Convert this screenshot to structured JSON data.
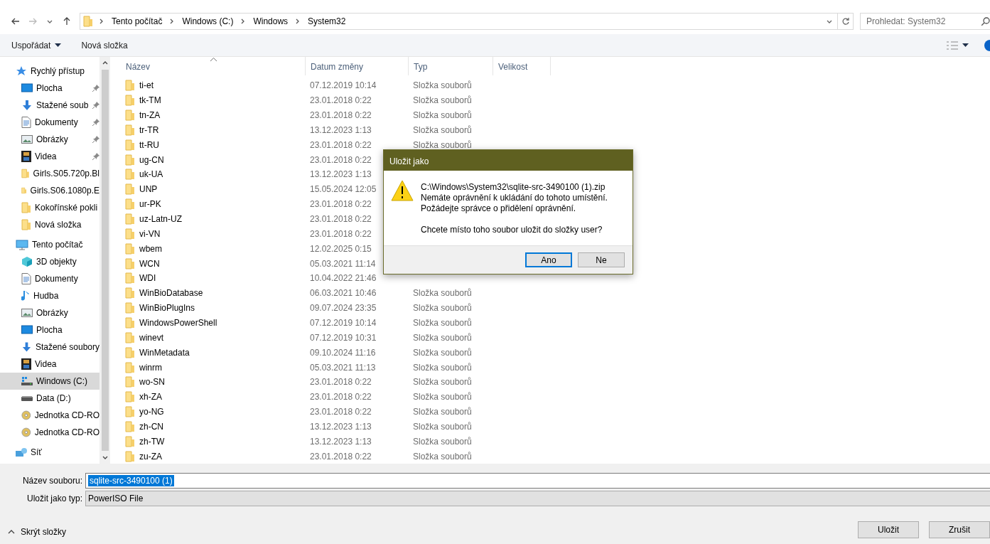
{
  "address_bar": {
    "breadcrumbs": [
      "Tento počítač",
      "Windows (C:)",
      "Windows",
      "System32"
    ],
    "search": {
      "placeholder": "Prohledat: System32"
    }
  },
  "toolbar": {
    "buttons": [
      {
        "label": "Uspořádat",
        "dropdown": true
      },
      {
        "label": "Nová složka",
        "dropdown": false
      }
    ]
  },
  "sidebar": {
    "sections": [
      {
        "label": "Rychlý přístup",
        "kind": "quick-access",
        "selected": false,
        "children": [
          {
            "label": "Plocha",
            "kind": "desktop",
            "pinned": true,
            "selected": false
          },
          {
            "label": "Stažené soub",
            "kind": "downloads",
            "pinned": true,
            "selected": false
          },
          {
            "label": "Dokumenty",
            "kind": "documents",
            "pinned": true,
            "selected": false
          },
          {
            "label": "Obrázky",
            "kind": "pictures",
            "pinned": true,
            "selected": false
          },
          {
            "label": "Videa",
            "kind": "videos",
            "pinned": true,
            "selected": false
          },
          {
            "label": "Girls.S05.720p.Bl",
            "kind": "folder",
            "pinned": false,
            "selected": false
          },
          {
            "label": "Girls.S06.1080p.E",
            "kind": "folder",
            "pinned": false,
            "selected": false
          },
          {
            "label": "Kokořínské pokli",
            "kind": "folder",
            "pinned": false,
            "selected": false
          },
          {
            "label": "Nová složka",
            "kind": "folder",
            "pinned": false,
            "selected": false
          }
        ]
      },
      {
        "label": "Tento počítač",
        "kind": "computer",
        "selected": false,
        "children": [
          {
            "label": "3D objekty",
            "kind": "objects3d",
            "pinned": false,
            "selected": false
          },
          {
            "label": "Dokumenty",
            "kind": "documents",
            "pinned": false,
            "selected": false
          },
          {
            "label": "Hudba",
            "kind": "music",
            "pinned": false,
            "selected": false
          },
          {
            "label": "Obrázky",
            "kind": "pictures",
            "pinned": false,
            "selected": false
          },
          {
            "label": "Plocha",
            "kind": "desktop",
            "pinned": false,
            "selected": false
          },
          {
            "label": "Stažené soubory",
            "kind": "downloads",
            "pinned": false,
            "selected": false
          },
          {
            "label": "Videa",
            "kind": "videos",
            "pinned": false,
            "selected": false
          },
          {
            "label": "Windows (C:)",
            "kind": "system-drive",
            "pinned": false,
            "selected": true
          },
          {
            "label": "Data (D:)",
            "kind": "drive",
            "pinned": false,
            "selected": false
          },
          {
            "label": "Jednotka CD-RO",
            "kind": "cd",
            "pinned": false,
            "selected": false
          },
          {
            "label": "Jednotka CD-RO",
            "kind": "cd",
            "pinned": false,
            "selected": false
          }
        ]
      },
      {
        "label": "Síť",
        "kind": "network",
        "selected": false
      }
    ]
  },
  "file_list": {
    "columns": [
      "Název",
      "Datum změny",
      "Typ",
      "Velikost"
    ],
    "rows": [
      {
        "name": "ti-et",
        "date": "07.12.2019 10:14",
        "type": "Složka souborů"
      },
      {
        "name": "tk-TM",
        "date": "23.01.2018 0:22",
        "type": "Složka souborů"
      },
      {
        "name": "tn-ZA",
        "date": "23.01.2018 0:22",
        "type": "Složka souborů"
      },
      {
        "name": "tr-TR",
        "date": "13.12.2023 1:13",
        "type": "Složka souborů"
      },
      {
        "name": "tt-RU",
        "date": "23.01.2018 0:22",
        "type": "Složka souborů"
      },
      {
        "name": "ug-CN",
        "date": "23.01.2018 0:22"
      },
      {
        "name": "uk-UA",
        "date": "13.12.2023 1:13"
      },
      {
        "name": "UNP",
        "date": "15.05.2024 12:05"
      },
      {
        "name": "ur-PK",
        "date": "23.01.2018 0:22"
      },
      {
        "name": "uz-Latn-UZ",
        "date": "23.01.2018 0:22"
      },
      {
        "name": "vi-VN",
        "date": "23.01.2018 0:22"
      },
      {
        "name": "wbem",
        "date": "12.02.2025 0:15"
      },
      {
        "name": "WCN",
        "date": "05.03.2021 11:14"
      },
      {
        "name": "WDI",
        "date": "10.04.2022 21:46"
      },
      {
        "name": "WinBioDatabase",
        "date": "06.03.2021 10:46",
        "type": "Složka souborů"
      },
      {
        "name": "WinBioPlugIns",
        "date": "09.07.2024 23:35",
        "type": "Složka souborů"
      },
      {
        "name": "WindowsPowerShell",
        "date": "07.12.2019 10:14",
        "type": "Složka souborů"
      },
      {
        "name": "winevt",
        "date": "07.12.2019 10:31",
        "type": "Složka souborů"
      },
      {
        "name": "WinMetadata",
        "date": "09.10.2024 11:16",
        "type": "Složka souborů"
      },
      {
        "name": "winrm",
        "date": "05.03.2021 11:13",
        "type": "Složka souborů"
      },
      {
        "name": "wo-SN",
        "date": "23.01.2018 0:22",
        "type": "Složka souborů"
      },
      {
        "name": "xh-ZA",
        "date": "23.01.2018 0:22",
        "type": "Složka souborů"
      },
      {
        "name": "yo-NG",
        "date": "23.01.2018 0:22",
        "type": "Složka souborů"
      },
      {
        "name": "zh-CN",
        "date": "13.12.2023 1:13",
        "type": "Složka souborů"
      },
      {
        "name": "zh-TW",
        "date": "13.12.2023 1:13",
        "type": "Složka souborů"
      },
      {
        "name": "zu-ZA",
        "date": "23.01.2018 0:22",
        "type": "Složka souborů"
      }
    ]
  },
  "save_panel": {
    "filename_label": "Název souboru:",
    "filename": {
      "value": "sqlite-src-3490100 (1)",
      "selected": true
    },
    "type_label": "Uložit jako typ:",
    "type_value": "PowerISO File",
    "hide_folders": "Skrýt složky",
    "buttons": [
      "Uložit",
      "Zrušit"
    ]
  },
  "dialog": {
    "title": "Uložit jako",
    "lines": [
      "C:\\Windows\\System32\\sqlite-src-3490100 (1).zip",
      "Nemáte oprávnění k ukládání do tohoto umístění.",
      "Požádejte správce o přidělení oprávnění."
    ],
    "question": "Chcete místo toho soubor uložit do složky user?",
    "buttons": [
      {
        "label": "Ano",
        "default": true
      },
      {
        "label": "Ne",
        "default": false
      }
    ]
  }
}
